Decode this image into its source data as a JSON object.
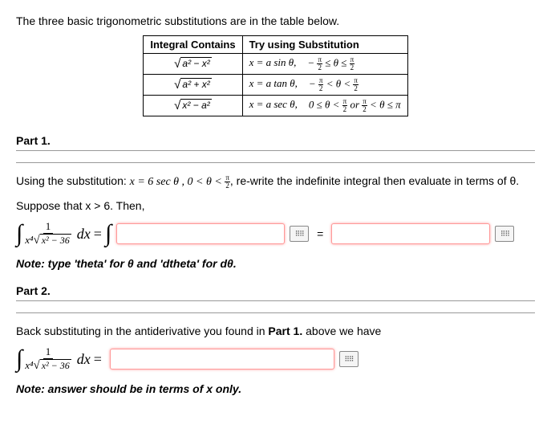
{
  "intro": "The three basic trigonometric substitutions are in the table below.",
  "table": {
    "h1": "Integral Contains",
    "h2": "Try using Substitution",
    "rows": [
      {
        "contains_inner": "a² − x²",
        "sub": "x = a sin θ,",
        "range_pre": "−",
        "range_mid": "≤ θ ≤"
      },
      {
        "contains_inner": "a² + x²",
        "sub": "x = a tan θ,",
        "range_pre": "−",
        "range_mid": "< θ <"
      },
      {
        "contains_inner": "x² − a²",
        "sub": "x = a sec θ,",
        "range_pre": "0 ≤ θ <",
        "range_mid": "or",
        "range_post": "< θ ≤ π"
      }
    ]
  },
  "part1": {
    "header": "Part 1.",
    "text_a": "Using the substitution: ",
    "text_sub": "x = 6 sec θ , 0 < θ < ",
    "text_b": ", re-write the indefinite integral then evaluate in terms of θ.",
    "suppose": "Suppose that x > 6. Then,",
    "integral_num": "1",
    "integral_den_left": "x⁴",
    "integral_den_root": "x² − 36",
    "dx": "dx",
    "eq1": "=",
    "eq2": "=",
    "note": "Note: type 'theta' for θ and 'dtheta' for dθ."
  },
  "part2": {
    "header": "Part 2.",
    "text": "Back substituting in the antiderivative you found in ",
    "bold": "Part 1.",
    "text2": " above we have",
    "integral_num": "1",
    "integral_den_left": "x⁴",
    "integral_den_root": "x² − 36",
    "dx": "dx",
    "eq": "=",
    "note": "Note: answer should be in terms of x only."
  }
}
